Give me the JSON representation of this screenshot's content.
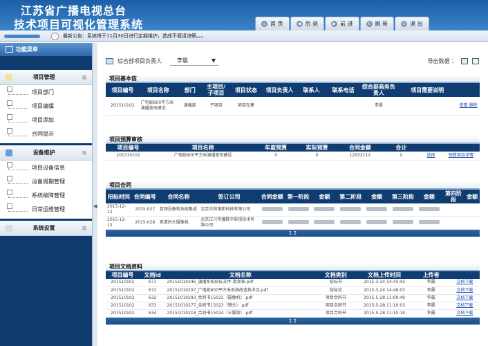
{
  "header": {
    "title_line1": "江苏省广播电视总台",
    "title_line2": "技术项目可视化管理系统",
    "nav": [
      {
        "label": "首 页",
        "icon": "home-icon"
      },
      {
        "label": "后 退",
        "icon": "back-icon"
      },
      {
        "label": "前 进",
        "icon": "forward-icon"
      },
      {
        "label": "刷 新",
        "icon": "refresh-icon"
      },
      {
        "label": "退 出",
        "icon": "power-icon"
      }
    ]
  },
  "notice": {
    "text": "最新公告：系统将于11月30日进行定期维护，造成不便请谅解。。。"
  },
  "sidebar": {
    "title": "功能菜单",
    "groups": [
      {
        "title": "项目管理",
        "items": [
          "项目部门",
          "项目编辑",
          "项目添加",
          "合同显示"
        ]
      },
      {
        "title": "设备维护",
        "items": [
          "项目设备信息",
          "设备周期管理",
          "系统故障管理",
          "日常运维管理"
        ]
      },
      {
        "title": "系统设置",
        "items": []
      }
    ]
  },
  "toolbar": {
    "label": "综合部项目负责人",
    "select_value": "李晨",
    "export_label": "导出数据 ："
  },
  "basic": {
    "title": "项目基本信",
    "headers": [
      "项目编号",
      "项目名称",
      "部门",
      "主项目/子项目",
      "项目状态",
      "项目负责人",
      "联系人",
      "联系电话",
      "综合部商务负责人",
      "项目需要说明",
      ""
    ],
    "row": [
      "201510102",
      "广电総800平方米演播室改建设",
      "演播部",
      "子项目",
      "项目在建",
      "",
      "",
      "",
      "李晨",
      "",
      "查看 删除"
    ]
  },
  "budget": {
    "title": "项目预算审核",
    "headers": [
      "项目编号",
      "项目名称",
      "年度预算",
      "实际预算",
      "合同金额",
      "合计",
      "",
      ""
    ],
    "row": [
      "201510102",
      "广电総800平方米演播室改建设",
      "0",
      "0",
      "12932112",
      "0",
      "选择",
      "预算项目详情"
    ]
  },
  "contract": {
    "title": "项目合同",
    "headers": [
      "招标时间",
      "合同编号",
      "合同名称",
      "签订公司",
      "合同金额",
      "第一阶段",
      "金额",
      "第二阶段",
      "金额",
      "第三阶段",
      "金额",
      "第四阶段",
      "金额"
    ],
    "rows": [
      [
        "2015-12-12",
        "2015-027",
        "音频设备和系统集成",
        "北京众和维新科技有限公司"
      ],
      [
        "2015-12-12",
        "2015-028",
        "高清拼头摄像机",
        "北京正兴传播数字影视技术有限公司"
      ]
    ],
    "pager": "1 2"
  },
  "docs": {
    "title": "项目文档资料",
    "headers": [
      "项目编号",
      "文档id",
      "文档名称",
      "文档类别",
      "文档上传时间",
      "上传者",
      ""
    ],
    "rows": [
      [
        "201510102",
        "671",
        "20151010246_演播系统招标文件-批发表.pdf",
        "招标书",
        "2015-3-24 14:45:42",
        "李晨",
        "文档下载"
      ],
      [
        "201510102",
        "672",
        "20151010297_广电総800平方米系统改造技术议.pdf",
        "招标议",
        "2015-3-24 14:46:03",
        "李晨",
        "文档下载"
      ],
      [
        "201510102",
        "632",
        "20151010293_合同书15022（摄像机）.pdf",
        "项目合同书",
        "2015-5-28 11:09:49",
        "李晨",
        "文档下载"
      ],
      [
        "201510102",
        "633",
        "20151010277_合同书15023（镜头）.pdf",
        "项目合同书",
        "2015-5-28 11:10:03",
        "李晨",
        "文档下载"
      ],
      [
        "201510102",
        "634",
        "20151010218_合同书15024（三脚架）.pdf",
        "项目合同书",
        "2015-5-28 11:10:19",
        "李晨",
        "文档下载"
      ]
    ],
    "pager": "1 2"
  }
}
